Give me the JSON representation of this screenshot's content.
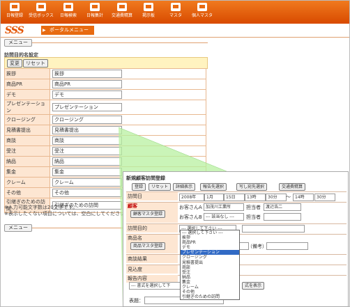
{
  "toolbar": {
    "items": [
      {
        "label": "日報登録"
      },
      {
        "label": "受信ボックス"
      },
      {
        "label": "日報検索"
      },
      {
        "label": "日報集計"
      },
      {
        "label": "交通費精算"
      },
      {
        "label": "掲示板"
      },
      {
        "label": "マスタ"
      },
      {
        "label": "個人マスタ"
      }
    ]
  },
  "header": {
    "logo": "SSS",
    "portal_menu": "ポータルメニュー"
  },
  "menu_tab_top": "メニュー",
  "menu_tab_bottom": "メニュー",
  "settings": {
    "title": "訪問目的名設定",
    "change_button": "変更",
    "reset_button": "リセット",
    "rows": [
      {
        "label": "挨拶",
        "value": "挨拶"
      },
      {
        "label": "商品PR",
        "value": "商品PR"
      },
      {
        "label": "デモ",
        "value": "デモ"
      },
      {
        "label": "プレゼンテーション",
        "value": "プレゼンテーション"
      },
      {
        "label": "クロージング",
        "value": "クロージング"
      },
      {
        "label": "見積書提出",
        "value": "見積書提出"
      },
      {
        "label": "商談",
        "value": "商談"
      },
      {
        "label": "受注",
        "value": "受注"
      },
      {
        "label": "納品",
        "value": "納品"
      },
      {
        "label": "集金",
        "value": "集金"
      },
      {
        "label": "クレーム",
        "value": "クレーム"
      },
      {
        "label": "その他",
        "value": "その他"
      },
      {
        "label": "引継ぎのための訪問",
        "value": "引継ぎのための訪問"
      }
    ],
    "note1": "※入力可能文字数は20文字です。",
    "note2": "※表示したくない項目については、空白にしてください。"
  },
  "popup": {
    "title": "新規顧客訪問登録",
    "buttons": {
      "register": "登録",
      "reset": "リセット",
      "detail": "詳細表示",
      "report_select": "報告先選択",
      "cc_select": "写し宛先選択",
      "transport": "交通費精算"
    },
    "visit_date_label": "訪問日",
    "year": "2008年",
    "month": "1月",
    "day": "15日",
    "hour_from": "13時",
    "min_from": "30分",
    "tilde": "～",
    "hour_to": "14時",
    "min_to": "30分",
    "customer_label": "顧客",
    "customer_a_label": "お客さんA",
    "customer_a_value": "加茂川工業所",
    "person_label": "担当者",
    "person_value": "渡辺浩二",
    "customer_master_btn": "顧客マスタ登録",
    "customer_b_label": "お客さんB",
    "customer_b_value": "--- 該当なし ---",
    "person_label_b": "担当者",
    "purpose_label": "訪問目的",
    "purpose_value": "--- 選択して下さい ---",
    "product_label": "商品名",
    "product_master_btn": "商品マスタ登録",
    "remarks": "（備考）",
    "result_label": "商談結果",
    "prospect_label": "見込度",
    "report_label": "報告内容",
    "template_select": "--- 書式を選択して下",
    "show_template": "式を表示",
    "subject_label": "表題："
  },
  "purpose_dropdown": {
    "selected": "プレゼンテーション",
    "options": [
      "--- 選択して下さい ---",
      "挨拶",
      "商品PR",
      "デモ",
      "プレゼンテーション",
      "クロージング",
      "見積書提出",
      "商談",
      "受注",
      "納品",
      "集金",
      "クレーム",
      "その他",
      "引継ぎのための訪問"
    ]
  },
  "colors": {
    "brand_orange": "#e35300",
    "label_bg": "#fde6d2",
    "callout_green": "#b8f0a0",
    "selection_blue": "#316ac5"
  }
}
